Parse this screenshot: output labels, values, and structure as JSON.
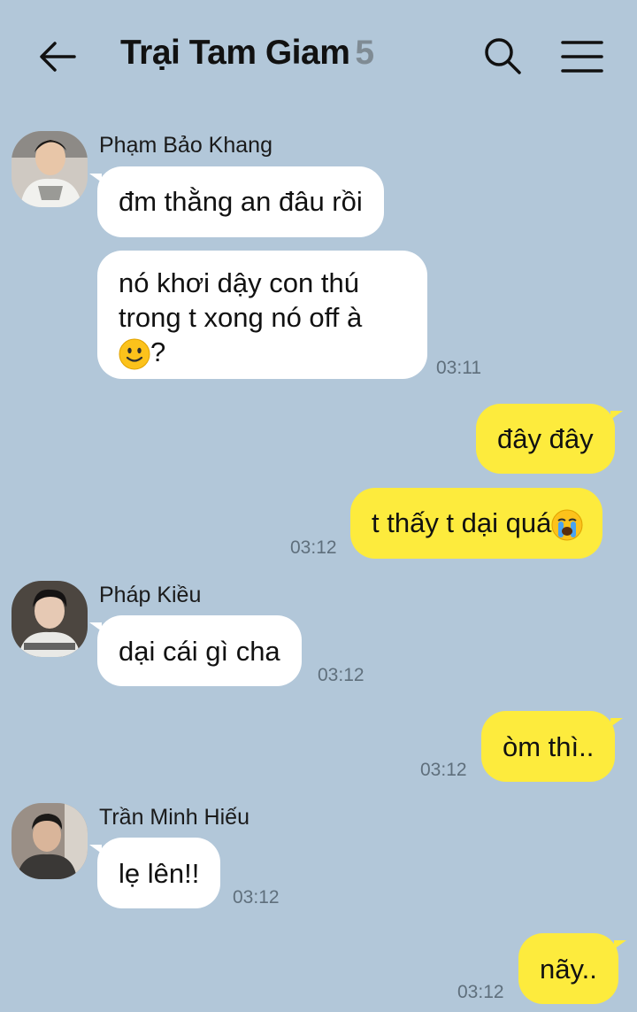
{
  "header": {
    "title": "Trại Tam Giam",
    "member_count": "5",
    "back_icon": "arrow-left-icon",
    "search_icon": "search-icon",
    "menu_icon": "hamburger-menu-icon"
  },
  "messages": [
    {
      "from": "Phạm Bảo Khang",
      "direction": "in",
      "text": "đm thằng an đâu rồi"
    },
    {
      "from": "Phạm Bảo Khang",
      "direction": "in",
      "lines": [
        "nó khơi dậy con thú",
        "trong t xong nó off à"
      ],
      "last_line": "?",
      "emoji": "slightly-smiling-face",
      "time": "03:11"
    },
    {
      "direction": "out",
      "text": "đây đây"
    },
    {
      "direction": "out",
      "text": "t thấy t dại quá",
      "emoji": "loudly-crying-face",
      "time": "03:12"
    },
    {
      "from": "Pháp Kiều",
      "direction": "in",
      "text": "dại cái gì cha",
      "time": "03:12"
    },
    {
      "direction": "out",
      "text": "òm thì..",
      "time": "03:12"
    },
    {
      "from": "Trần Minh Hiếu",
      "direction": "in",
      "text": "lẹ lên!!",
      "time": "03:12"
    },
    {
      "direction": "out",
      "text": "nãy..",
      "time": "03:12"
    }
  ],
  "colors": {
    "background": "#b2c7d9",
    "incoming_bubble": "#ffffff",
    "outgoing_bubble": "#fdeb3d",
    "timestamp": "#5f6f7c",
    "member_count": "#7f8b94"
  }
}
